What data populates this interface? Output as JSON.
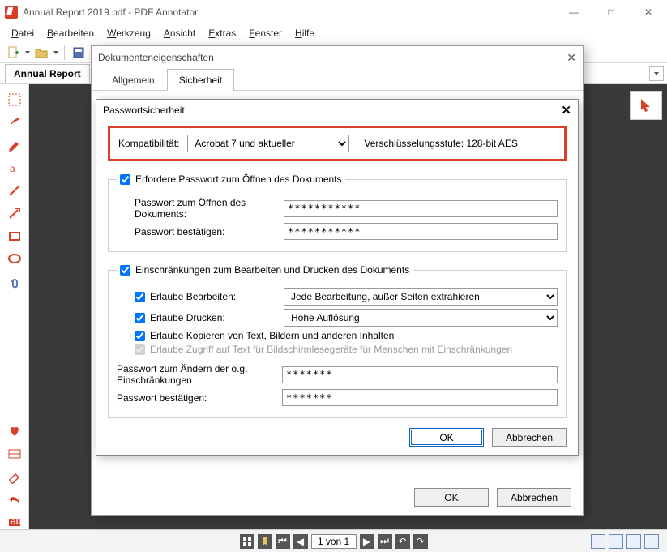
{
  "window": {
    "title": "Annual Report 2019.pdf - PDF Annotator",
    "doc_tab": "Annual Report",
    "select_label": "Auswählen",
    "pager_text": "1 von 1"
  },
  "menu": {
    "datei": "Datei",
    "bearbeiten": "Bearbeiten",
    "werkzeug": "Werkzeug",
    "ansicht": "Ansicht",
    "extras": "Extras",
    "fenster": "Fenster",
    "hilfe": "Hilfe"
  },
  "props_dialog": {
    "title": "Dokumenteneigenschaften",
    "tab_general": "Allgemein",
    "tab_security": "Sicherheit",
    "ok": "OK",
    "cancel": "Abbrechen"
  },
  "pwd_dialog": {
    "title": "Passwortsicherheit",
    "compat_label": "Kompatibilität:",
    "compat_value": "Acrobat 7 und aktueller",
    "enc_label": "Verschlüsselungsstufe: 128-bit AES",
    "require_open_pw": "Erfordere Passwort zum Öffnen des Dokuments",
    "open_pw_label": "Passwort zum Öffnen des Dokuments:",
    "open_pw_value": "***********",
    "open_pw_confirm_label": "Passwort bestätigen:",
    "open_pw_confirm_value": "***********",
    "restrict_legend": "Einschränkungen zum Bearbeiten und Drucken des Dokuments",
    "allow_edit_label": "Erlaube Bearbeiten:",
    "allow_edit_value": "Jede  Bearbeitung, außer Seiten extrahieren",
    "allow_print_label": "Erlaube Drucken:",
    "allow_print_value": "Hohe Auflösung",
    "allow_copy": "Erlaube Kopieren von Text, Bildern und anderen Inhalten",
    "allow_access": "Erlaube Zugriff auf Text für Bildschirmlesegeräte für Menschen mit Einschränkungen",
    "perm_pw_label": "Passwort zum Ändern der o.g. Einschränkungen",
    "perm_pw_value": "*******",
    "perm_pw_confirm_label": "Passwort bestätigen:",
    "perm_pw_confirm_value": "*******",
    "ok": "OK",
    "cancel": "Abbrechen"
  }
}
